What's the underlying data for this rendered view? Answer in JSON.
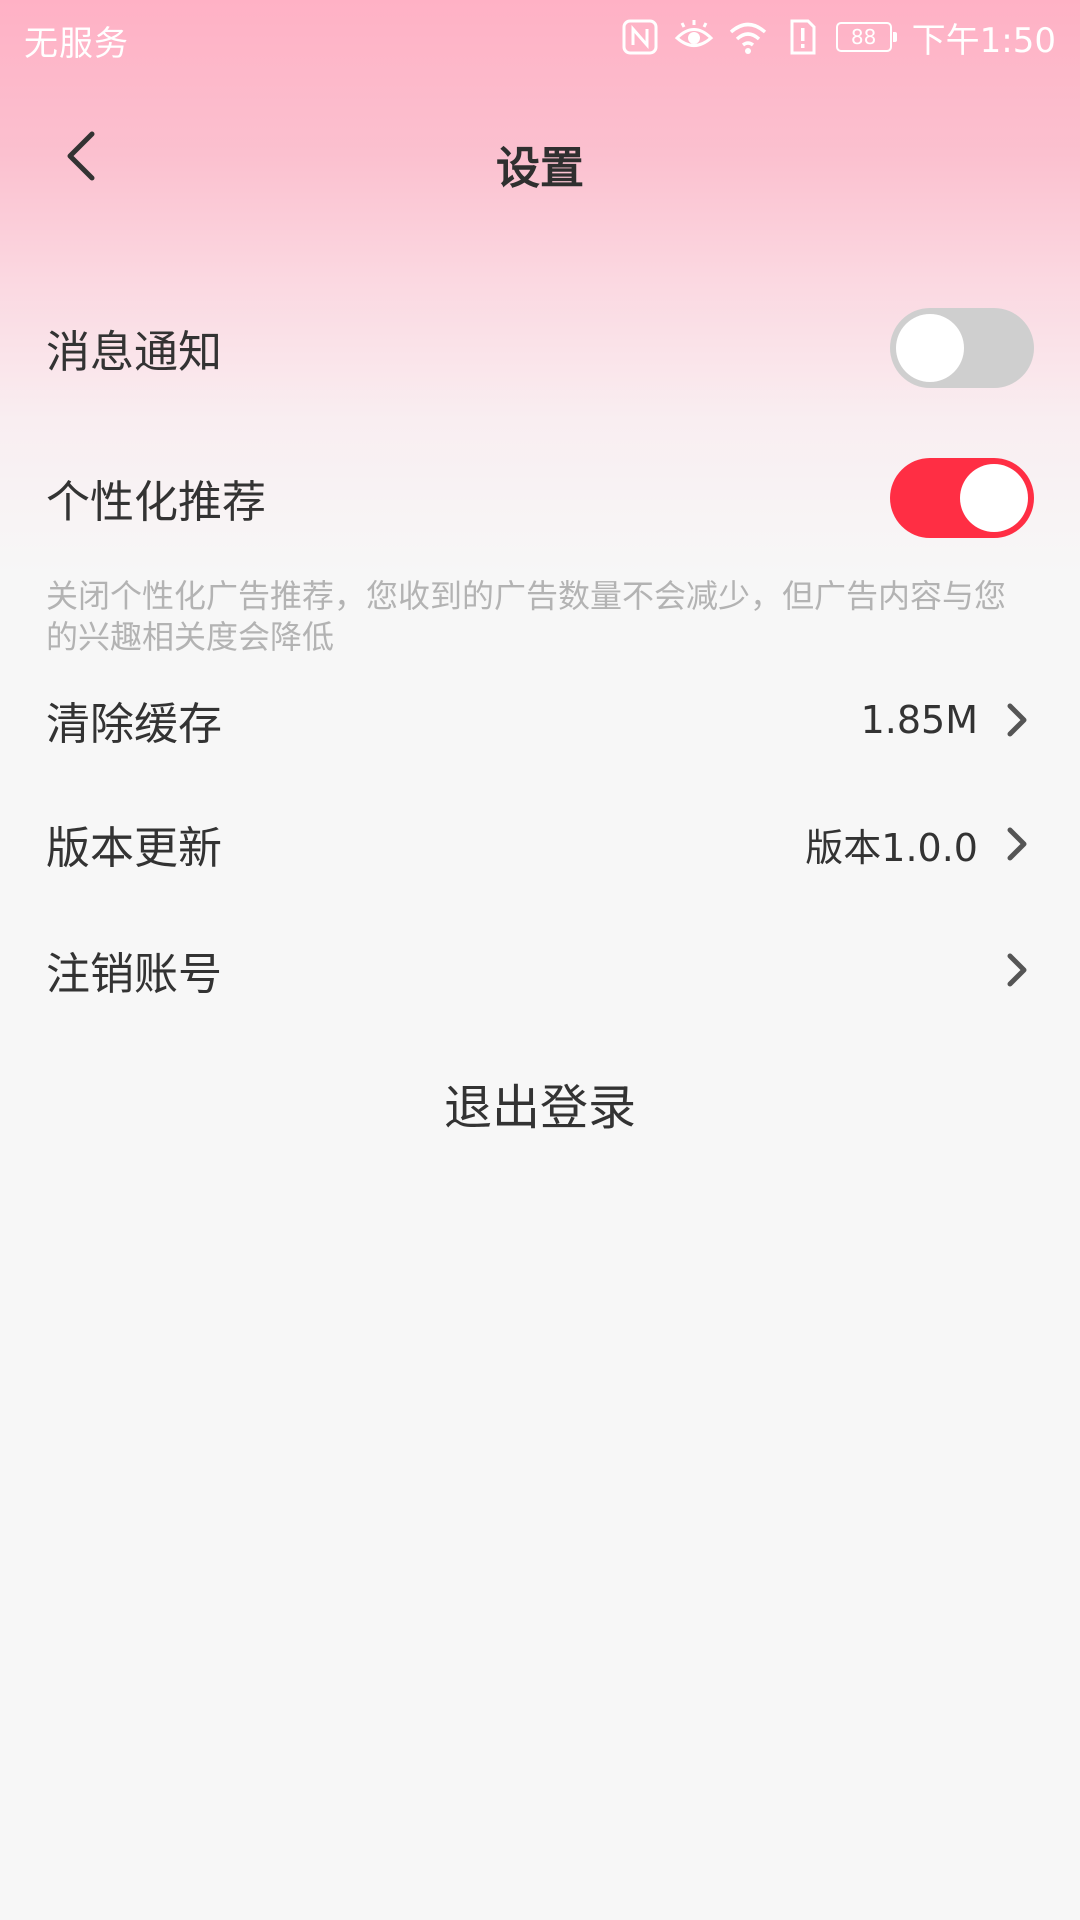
{
  "status_bar": {
    "carrier": "无服务",
    "battery": "88",
    "time": "下午1:50",
    "icons": [
      "nfc-icon",
      "eye-icon",
      "wifi-icon",
      "alert-icon",
      "battery-icon"
    ]
  },
  "header": {
    "title": "设置",
    "back_icon": "back-arrow-icon"
  },
  "settings": {
    "notifications": {
      "label": "消息通知",
      "enabled": false
    },
    "personalized": {
      "label": "个性化推荐",
      "enabled": true,
      "description": "关闭个性化广告推荐，您收到的广告数量不会减少，但广告内容与您的兴趣相关度会降低"
    },
    "clear_cache": {
      "label": "清除缓存",
      "value": "1.85M"
    },
    "version_update": {
      "label": "版本更新",
      "value": "版本1.0.0"
    },
    "delete_account": {
      "label": "注销账号"
    }
  },
  "logout_label": "退出登录",
  "colors": {
    "toggle_on": "#ff2e44",
    "toggle_off": "#cfcfcf",
    "header_gradient_top": "#ffb1c5"
  }
}
